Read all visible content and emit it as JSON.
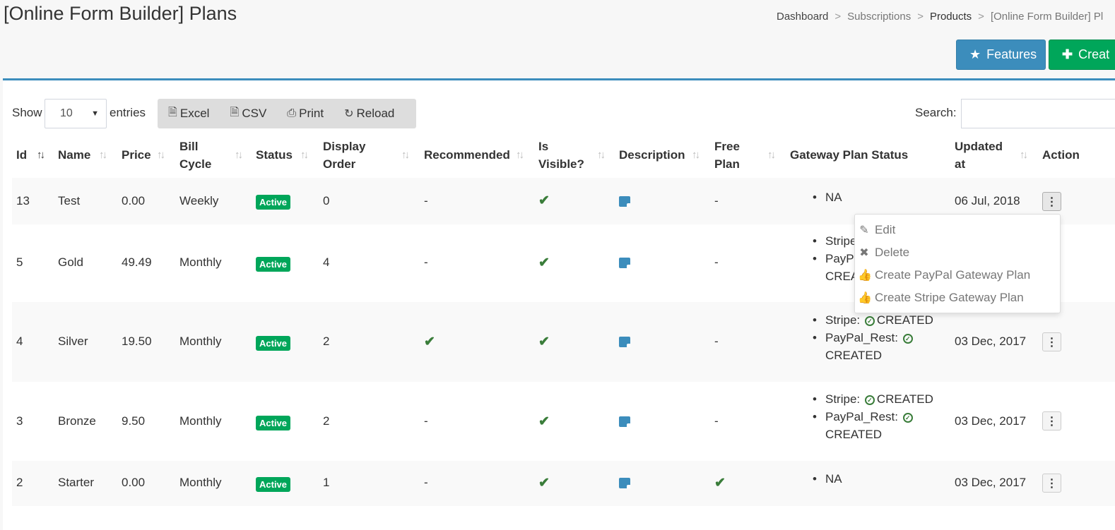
{
  "page": {
    "title": "[Online Form Builder] Plans",
    "breadcrumb": [
      "Dashboard",
      "Subscriptions",
      "Products",
      "[Online Form Builder] Pl"
    ],
    "buttons": {
      "features": "Features",
      "create": "Creat"
    }
  },
  "toolbar": {
    "show_label": "Show",
    "entries_value": "10",
    "entries_label": "entries",
    "export_buttons": [
      "Excel",
      "CSV",
      "Print",
      "Reload"
    ],
    "search_label": "Search:",
    "search_value": ""
  },
  "table": {
    "columns": {
      "id": "Id",
      "name": "Name",
      "price": "Price",
      "bill_cycle_1": "Bill",
      "bill_cycle_2": "Cycle",
      "status": "Status",
      "display_order_1": "Display",
      "display_order_2": "Order",
      "recommended": "Recommended",
      "visible_1": "Is",
      "visible_2": "Visible?",
      "description": "Description",
      "free_plan_1": "Free",
      "free_plan_2": "Plan",
      "gateway": "Gateway Plan Status",
      "updated_1": "Updated",
      "updated_2": "at",
      "action": "Action"
    },
    "rows": [
      {
        "id": "13",
        "name": "Test",
        "price": "0.00",
        "bill_cycle": "Weekly",
        "status": "Active",
        "display_order": "0",
        "recommended": "-",
        "free_plan": "-",
        "gateway": [
          "NA"
        ],
        "updated": "06 Jul, 2018"
      },
      {
        "id": "5",
        "name": "Gold",
        "price": "49.49",
        "bill_cycle": "Monthly",
        "status": "Active",
        "display_order": "4",
        "recommended": "-",
        "free_plan": "-",
        "gateway_1": "Stripe",
        "gateway_2": "PayPal",
        "gateway_3": "CREAT",
        "updated": ""
      },
      {
        "id": "4",
        "name": "Silver",
        "price": "19.50",
        "bill_cycle": "Monthly",
        "status": "Active",
        "display_order": "2",
        "free_plan": "-",
        "gateway_stripe": "Stripe:",
        "gateway_stripe_status": "CREATED",
        "gateway_paypal": "PayPal_Rest:",
        "gateway_paypal_status": "CREATED",
        "updated": "03 Dec, 2017"
      },
      {
        "id": "3",
        "name": "Bronze",
        "price": "9.50",
        "bill_cycle": "Monthly",
        "status": "Active",
        "display_order": "2",
        "recommended": "-",
        "free_plan": "-",
        "gateway_stripe": "Stripe:",
        "gateway_stripe_status": "CREATED",
        "gateway_paypal": "PayPal_Rest:",
        "gateway_paypal_status": "CREATED",
        "updated": "03 Dec, 2017"
      },
      {
        "id": "2",
        "name": "Starter",
        "price": "0.00",
        "bill_cycle": "Monthly",
        "status": "Active",
        "display_order": "1",
        "recommended": "-",
        "gateway": [
          "NA"
        ],
        "updated": "03 Dec, 2017"
      }
    ]
  },
  "action_menu": {
    "items": [
      "Edit",
      "Delete",
      "Create PayPal Gateway Plan",
      "Create Stripe Gateway Plan"
    ]
  },
  "colors": {
    "primary": "#3c8dbc",
    "success": "#00a65a",
    "check": "#3a7d3a"
  },
  "icons": [
    "star-icon",
    "plus-icon",
    "excel-icon",
    "csv-icon",
    "print-icon",
    "refresh-icon",
    "check-icon",
    "note-icon",
    "ellipsis-vertical-icon",
    "pencil-icon",
    "times-icon",
    "thumbs-up-icon"
  ]
}
